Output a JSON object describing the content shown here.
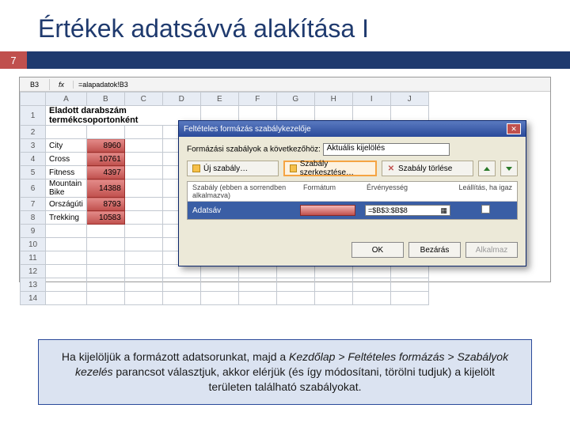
{
  "title": "Értékek adatsávvá alakítása I",
  "slide_number": "7",
  "formula_bar": {
    "cell_ref": "B3",
    "fx_label": "fx",
    "formula": "=alapadatok!B3"
  },
  "columns": [
    "A",
    "B",
    "C",
    "D",
    "E",
    "F",
    "G",
    "H",
    "I",
    "J"
  ],
  "row_numbers": [
    "1",
    "2",
    "3",
    "4",
    "5",
    "6",
    "7",
    "8",
    "9",
    "10",
    "11",
    "12",
    "13",
    "14"
  ],
  "sheet_title": "Eladott darabszám termékcsoportonként",
  "rows": [
    {
      "label": "City",
      "value": "8960"
    },
    {
      "label": "Cross",
      "value": "10761"
    },
    {
      "label": "Fitness",
      "value": "4397"
    },
    {
      "label": "Mountain Bike",
      "value": "14388"
    },
    {
      "label": "Országúti",
      "value": "8793"
    },
    {
      "label": "Trekking",
      "value": "10583"
    }
  ],
  "dialog": {
    "title": "Feltételes formázás szabálykezelője",
    "rules_for_label": "Formázási szabályok a következőhöz:",
    "scope_value": "Aktuális kijelölés",
    "btn_new": "Új szabály…",
    "btn_edit": "Szabály szerkesztése…",
    "btn_delete": "Szabály törlése",
    "col_rule": "Szabály (ebben a sorrendben alkalmazva)",
    "col_format": "Formátum",
    "col_scope": "Érvényesség",
    "col_stop": "Leállítás, ha igaz",
    "rule_name": "Adatsáv",
    "rule_ref": "=$B$3:$B$8",
    "ok": "OK",
    "close": "Bezárás",
    "apply": "Alkalmaz"
  },
  "footer": {
    "p1a": "Ha kijelöljük a formázott adatsorunkat, majd a ",
    "p1b": "Kezdőlap > Feltételes formázás > Szabályok kezelés",
    "p1c": " parancsot választjuk, akkor elérjük (és így módosítani, törölni tudjuk) a kijelölt területen található szabályokat."
  },
  "chart_data": {
    "type": "bar",
    "title": "Eladott darabszám termékcsoportonként",
    "categories": [
      "City",
      "Cross",
      "Fitness",
      "Mountain Bike",
      "Országúti",
      "Trekking"
    ],
    "values": [
      8960,
      10761,
      4397,
      14388,
      8793,
      10583
    ],
    "xlabel": "",
    "ylabel": "",
    "ylim": [
      0,
      15000
    ]
  }
}
